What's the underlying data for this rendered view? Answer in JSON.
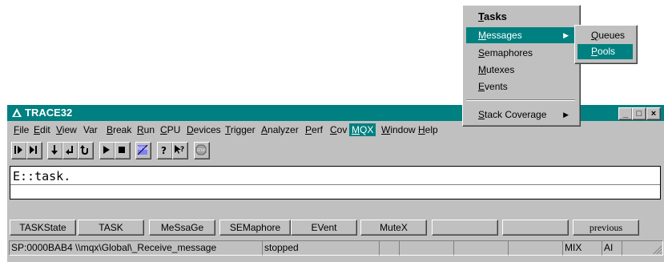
{
  "window": {
    "title": "TRACE32"
  },
  "menubar": [
    {
      "label": "File",
      "key": "F"
    },
    {
      "label": "Edit",
      "key": "E"
    },
    {
      "label": "View",
      "key": "V"
    },
    {
      "label": "Var",
      "key": ""
    },
    {
      "label": "Break",
      "key": "B"
    },
    {
      "label": "Run",
      "key": "R"
    },
    {
      "label": "CPU",
      "key": "C"
    },
    {
      "label": "Devices",
      "key": "D"
    },
    {
      "label": "Trigger",
      "key": "T"
    },
    {
      "label": "Analyzer",
      "key": "A"
    },
    {
      "label": "Perf",
      "key": "P"
    },
    {
      "label": "Cov",
      "key": "C"
    },
    {
      "label": "MQX",
      "key": "M"
    },
    {
      "label": "Window",
      "key": "W"
    },
    {
      "label": "Help",
      "key": "H"
    }
  ],
  "toolbar_icons": [
    "step-icon",
    "step-over-icon",
    "down-icon",
    "return-icon",
    "undo-icon",
    "go-icon",
    "stop-icon",
    "nowin-icon",
    "help-icon",
    "context-help-icon",
    "stop-sign-icon"
  ],
  "command_line": {
    "value": "E::task."
  },
  "softkeys": [
    "TASKState",
    "TASK",
    "MeSsaGe",
    "SEMaphore",
    "EVent",
    "MuteX",
    "",
    "",
    "",
    "previous"
  ],
  "statusbar": {
    "location": "SP:0000BAB4  \\\\mqx\\Global\\_Receive_message",
    "state": "stopped",
    "mode": "MIX",
    "ai": "AI"
  },
  "mqx_menu": {
    "items": [
      {
        "label": "Tasks",
        "bold": true
      },
      {
        "label": "Messages",
        "submenu": true,
        "highlighted": true
      },
      {
        "label": "Semaphores"
      },
      {
        "label": "Mutexes"
      },
      {
        "label": "Events"
      },
      {
        "label": "Stack Coverage",
        "submenu": true
      }
    ]
  },
  "messages_submenu": {
    "items": [
      {
        "label": "Queues"
      },
      {
        "label": "Pools",
        "highlighted": true
      }
    ]
  },
  "colors": {
    "title_bar": "#008080",
    "face": "#c0c0c0",
    "highlight": "#008080"
  }
}
